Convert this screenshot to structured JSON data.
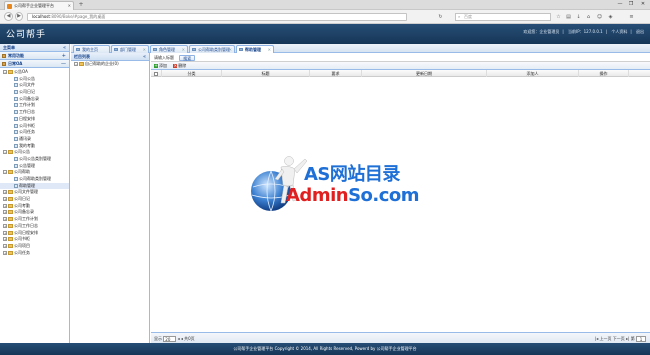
{
  "browser": {
    "tab_title": "公司帮手企业管理平台",
    "new_tab": "+",
    "url_host": "localhost",
    "url_path": ":8090/Boke/#page_我的桌面",
    "search_placeholder": "百度",
    "window_buttons": [
      "—",
      "❐",
      "✕"
    ]
  },
  "app": {
    "logo": "公司帮手",
    "header_links": [
      "欢迎您：企业管理员",
      "当前IP：127.0.0.1",
      "个人资料",
      "退出"
    ]
  },
  "left_panel": {
    "title": "主菜单",
    "sections": [
      {
        "label": "常用功能",
        "toggle": "+"
      },
      {
        "label": "日常OA",
        "toggle": "—"
      }
    ],
    "tree": [
      {
        "label": "公告OA",
        "level": 0,
        "type": "folder",
        "toggle": "−"
      },
      {
        "label": "公司公告",
        "level": 1,
        "type": "page"
      },
      {
        "label": "公司文件",
        "level": 1,
        "type": "page"
      },
      {
        "label": "公司日记",
        "level": 1,
        "type": "page"
      },
      {
        "label": "公司备忘录",
        "level": 1,
        "type": "page"
      },
      {
        "label": "工作计划",
        "level": 1,
        "type": "page"
      },
      {
        "label": "工作日志",
        "level": 1,
        "type": "page"
      },
      {
        "label": "日程安排",
        "level": 1,
        "type": "page"
      },
      {
        "label": "公司书柜",
        "level": 1,
        "type": "page"
      },
      {
        "label": "公司任务",
        "level": 1,
        "type": "page"
      },
      {
        "label": "通讯录",
        "level": 1,
        "type": "page"
      },
      {
        "label": "我的考勤",
        "level": 1,
        "type": "page"
      },
      {
        "label": "公司公告",
        "level": 0,
        "type": "folder",
        "toggle": "−"
      },
      {
        "label": "公司公告类别管理",
        "level": 1,
        "type": "page"
      },
      {
        "label": "公告管理",
        "level": 1,
        "type": "page"
      },
      {
        "label": "公司帮助",
        "level": 0,
        "type": "folder",
        "toggle": "−"
      },
      {
        "label": "公司帮助类别管理",
        "level": 1,
        "type": "page"
      },
      {
        "label": "帮助管理",
        "level": 1,
        "type": "page",
        "selected": true
      },
      {
        "label": "公司文件管理",
        "level": 0,
        "type": "folder",
        "toggle": "+"
      },
      {
        "label": "公司日记",
        "level": 0,
        "type": "folder",
        "toggle": "+"
      },
      {
        "label": "公司考勤",
        "level": 0,
        "type": "folder",
        "toggle": "+"
      },
      {
        "label": "公司备忘录",
        "level": 0,
        "type": "folder",
        "toggle": "+"
      },
      {
        "label": "公司工作计划",
        "level": 0,
        "type": "folder",
        "toggle": "+"
      },
      {
        "label": "公司工作日志",
        "level": 0,
        "type": "folder",
        "toggle": "+"
      },
      {
        "label": "公司日程安排",
        "level": 0,
        "type": "folder",
        "toggle": "+"
      },
      {
        "label": "公司书柜",
        "level": 0,
        "type": "folder",
        "toggle": "+"
      },
      {
        "label": "公司项目",
        "level": 0,
        "type": "folder",
        "toggle": "+"
      },
      {
        "label": "公司任务",
        "level": 0,
        "type": "folder",
        "toggle": "+"
      }
    ]
  },
  "tabs": [
    {
      "label": "我的主页",
      "active": false
    },
    {
      "label": "部门管理",
      "active": false
    },
    {
      "label": "角色管理",
      "active": false
    },
    {
      "label": "公司帮助类别管理",
      "active": false
    },
    {
      "label": "帮助管理",
      "active": true
    }
  ],
  "column_panel": {
    "title": "栏目列表",
    "collapse": "«",
    "root": "自己帮助的企业(0)"
  },
  "right_panel": {
    "tab_title_label": "请输入标题",
    "save_label": "搜索",
    "toolbar": [
      {
        "label": "添加",
        "icon": "add-icon",
        "color": "#2e9d2e"
      },
      {
        "label": "删除",
        "icon": "delete-icon",
        "color": "#d23b2a"
      }
    ],
    "columns": [
      "分类",
      "标题",
      "要求",
      "更新日期",
      "添加人",
      "操作"
    ]
  },
  "pager": {
    "page_size": "20",
    "left_text": "显示",
    "first_controls": "◂ ◂",
    "page_label": "第",
    "page_value": "1",
    "total_pages": "共0页",
    "right_controls": "|◂ 上一页 下一页 ▸|"
  },
  "footer": {
    "text": "公司帮手企业管理平台 Copyright © 2014, All Rights Reserved, Powerd by 公司帮手企业管理平台"
  },
  "watermark": {
    "line1": "AS网站目录",
    "line2_a": "Admin",
    "line2_b": "So",
    "line2_c": ".com",
    "colors": {
      "blue": "#1e6fd6",
      "red": "#e02020"
    }
  }
}
